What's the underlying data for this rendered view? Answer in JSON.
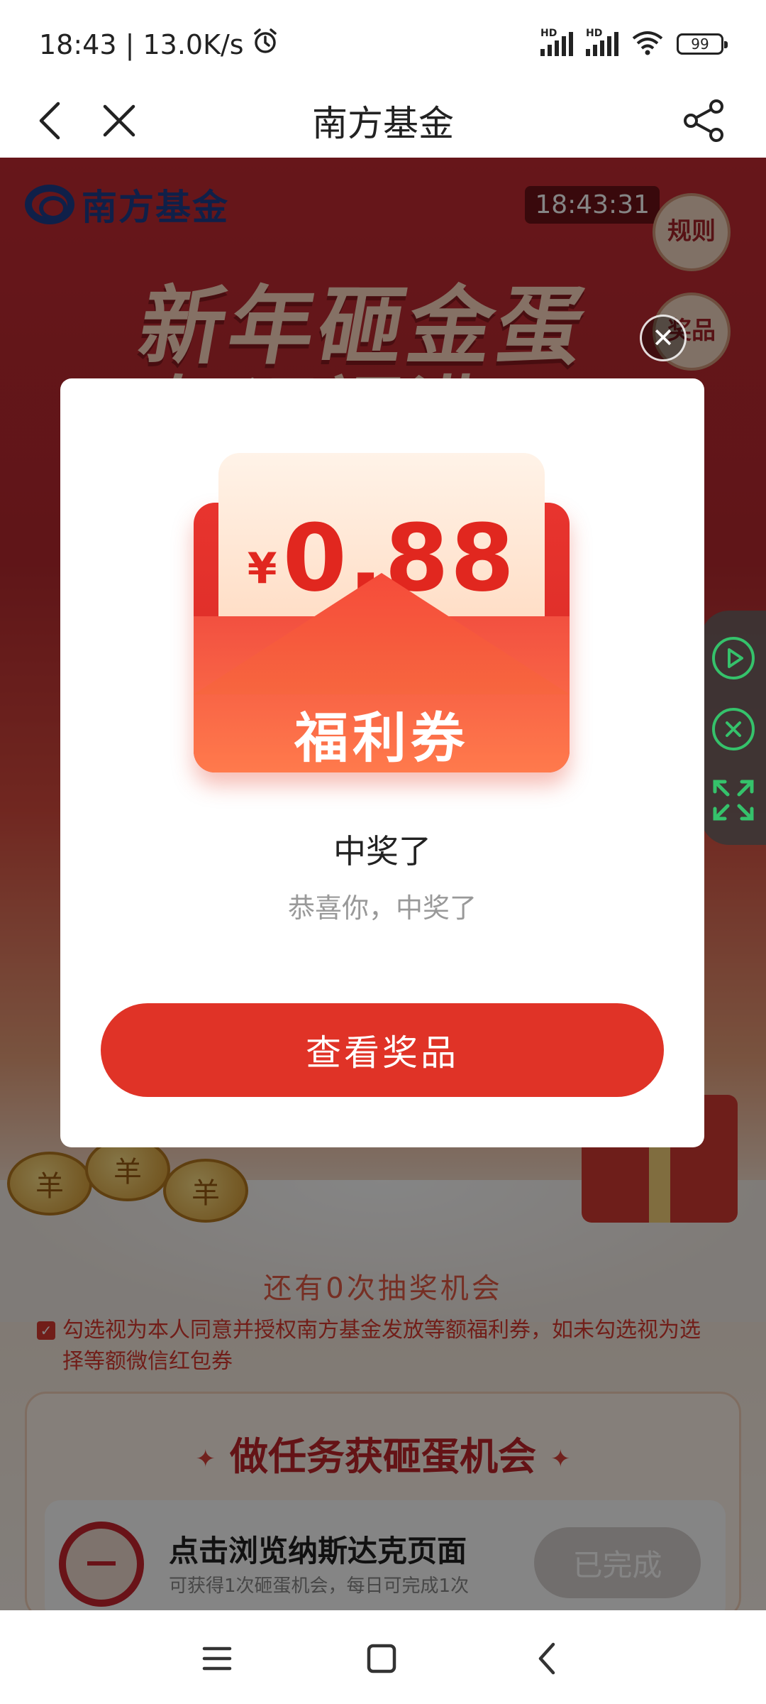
{
  "status_bar": {
    "time_speed": "18:43 | 13.0K/s",
    "battery": "99",
    "hd_label": "HD"
  },
  "nav": {
    "title": "南方基金"
  },
  "page": {
    "brand": "南方基金",
    "clock": "18:43:31",
    "rules_tab": "规则",
    "prize_tab": "奖品",
    "hero_title": "新年砸金蛋",
    "hero_subtitle": "好运福满天",
    "coin_char": "羊",
    "chances_text": "还有0次抽奖机会",
    "agree_checkbox": "✓",
    "agree_text": "勾选视为本人同意并授权南方基金发放等额福利券，如未勾选视为选择等额微信红包券",
    "task_panel": {
      "title": "做任务获砸蛋机会",
      "star": "✦",
      "task": {
        "name": "点击浏览纳斯达克页面",
        "desc": "可获得1次砸蛋机会，每日可完成1次",
        "button": "已完成"
      }
    }
  },
  "modal": {
    "close_glyph": "✕",
    "yen": "¥",
    "amount": "0.88",
    "coupon_label": "福利券",
    "title": "中奖了",
    "subtitle": "恭喜你，中奖了",
    "button": "查看奖品"
  },
  "colors": {
    "brand_red": "#e03327",
    "widget_green": "#35c26b",
    "logo_blue": "#1d3f8c"
  }
}
